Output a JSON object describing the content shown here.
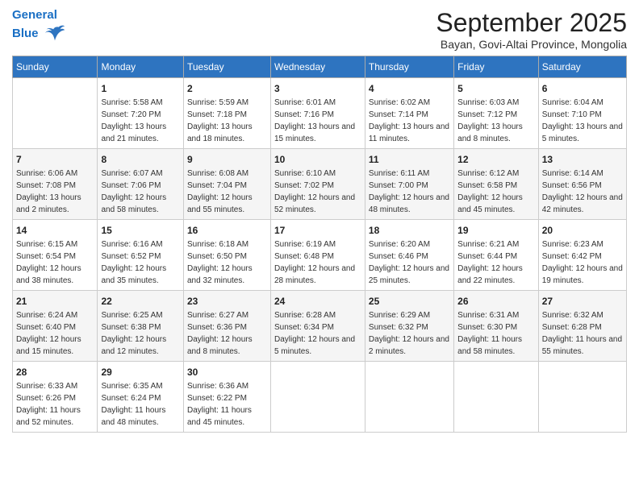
{
  "logo": {
    "line1": "General",
    "line2": "Blue"
  },
  "title": "September 2025",
  "subtitle": "Bayan, Govi-Altai Province, Mongolia",
  "days_of_week": [
    "Sunday",
    "Monday",
    "Tuesday",
    "Wednesday",
    "Thursday",
    "Friday",
    "Saturday"
  ],
  "weeks": [
    [
      {
        "num": "",
        "sunrise": "",
        "sunset": "",
        "daylight": ""
      },
      {
        "num": "1",
        "sunrise": "Sunrise: 5:58 AM",
        "sunset": "Sunset: 7:20 PM",
        "daylight": "Daylight: 13 hours and 21 minutes."
      },
      {
        "num": "2",
        "sunrise": "Sunrise: 5:59 AM",
        "sunset": "Sunset: 7:18 PM",
        "daylight": "Daylight: 13 hours and 18 minutes."
      },
      {
        "num": "3",
        "sunrise": "Sunrise: 6:01 AM",
        "sunset": "Sunset: 7:16 PM",
        "daylight": "Daylight: 13 hours and 15 minutes."
      },
      {
        "num": "4",
        "sunrise": "Sunrise: 6:02 AM",
        "sunset": "Sunset: 7:14 PM",
        "daylight": "Daylight: 13 hours and 11 minutes."
      },
      {
        "num": "5",
        "sunrise": "Sunrise: 6:03 AM",
        "sunset": "Sunset: 7:12 PM",
        "daylight": "Daylight: 13 hours and 8 minutes."
      },
      {
        "num": "6",
        "sunrise": "Sunrise: 6:04 AM",
        "sunset": "Sunset: 7:10 PM",
        "daylight": "Daylight: 13 hours and 5 minutes."
      }
    ],
    [
      {
        "num": "7",
        "sunrise": "Sunrise: 6:06 AM",
        "sunset": "Sunset: 7:08 PM",
        "daylight": "Daylight: 13 hours and 2 minutes."
      },
      {
        "num": "8",
        "sunrise": "Sunrise: 6:07 AM",
        "sunset": "Sunset: 7:06 PM",
        "daylight": "Daylight: 12 hours and 58 minutes."
      },
      {
        "num": "9",
        "sunrise": "Sunrise: 6:08 AM",
        "sunset": "Sunset: 7:04 PM",
        "daylight": "Daylight: 12 hours and 55 minutes."
      },
      {
        "num": "10",
        "sunrise": "Sunrise: 6:10 AM",
        "sunset": "Sunset: 7:02 PM",
        "daylight": "Daylight: 12 hours and 52 minutes."
      },
      {
        "num": "11",
        "sunrise": "Sunrise: 6:11 AM",
        "sunset": "Sunset: 7:00 PM",
        "daylight": "Daylight: 12 hours and 48 minutes."
      },
      {
        "num": "12",
        "sunrise": "Sunrise: 6:12 AM",
        "sunset": "Sunset: 6:58 PM",
        "daylight": "Daylight: 12 hours and 45 minutes."
      },
      {
        "num": "13",
        "sunrise": "Sunrise: 6:14 AM",
        "sunset": "Sunset: 6:56 PM",
        "daylight": "Daylight: 12 hours and 42 minutes."
      }
    ],
    [
      {
        "num": "14",
        "sunrise": "Sunrise: 6:15 AM",
        "sunset": "Sunset: 6:54 PM",
        "daylight": "Daylight: 12 hours and 38 minutes."
      },
      {
        "num": "15",
        "sunrise": "Sunrise: 6:16 AM",
        "sunset": "Sunset: 6:52 PM",
        "daylight": "Daylight: 12 hours and 35 minutes."
      },
      {
        "num": "16",
        "sunrise": "Sunrise: 6:18 AM",
        "sunset": "Sunset: 6:50 PM",
        "daylight": "Daylight: 12 hours and 32 minutes."
      },
      {
        "num": "17",
        "sunrise": "Sunrise: 6:19 AM",
        "sunset": "Sunset: 6:48 PM",
        "daylight": "Daylight: 12 hours and 28 minutes."
      },
      {
        "num": "18",
        "sunrise": "Sunrise: 6:20 AM",
        "sunset": "Sunset: 6:46 PM",
        "daylight": "Daylight: 12 hours and 25 minutes."
      },
      {
        "num": "19",
        "sunrise": "Sunrise: 6:21 AM",
        "sunset": "Sunset: 6:44 PM",
        "daylight": "Daylight: 12 hours and 22 minutes."
      },
      {
        "num": "20",
        "sunrise": "Sunrise: 6:23 AM",
        "sunset": "Sunset: 6:42 PM",
        "daylight": "Daylight: 12 hours and 19 minutes."
      }
    ],
    [
      {
        "num": "21",
        "sunrise": "Sunrise: 6:24 AM",
        "sunset": "Sunset: 6:40 PM",
        "daylight": "Daylight: 12 hours and 15 minutes."
      },
      {
        "num": "22",
        "sunrise": "Sunrise: 6:25 AM",
        "sunset": "Sunset: 6:38 PM",
        "daylight": "Daylight: 12 hours and 12 minutes."
      },
      {
        "num": "23",
        "sunrise": "Sunrise: 6:27 AM",
        "sunset": "Sunset: 6:36 PM",
        "daylight": "Daylight: 12 hours and 8 minutes."
      },
      {
        "num": "24",
        "sunrise": "Sunrise: 6:28 AM",
        "sunset": "Sunset: 6:34 PM",
        "daylight": "Daylight: 12 hours and 5 minutes."
      },
      {
        "num": "25",
        "sunrise": "Sunrise: 6:29 AM",
        "sunset": "Sunset: 6:32 PM",
        "daylight": "Daylight: 12 hours and 2 minutes."
      },
      {
        "num": "26",
        "sunrise": "Sunrise: 6:31 AM",
        "sunset": "Sunset: 6:30 PM",
        "daylight": "Daylight: 11 hours and 58 minutes."
      },
      {
        "num": "27",
        "sunrise": "Sunrise: 6:32 AM",
        "sunset": "Sunset: 6:28 PM",
        "daylight": "Daylight: 11 hours and 55 minutes."
      }
    ],
    [
      {
        "num": "28",
        "sunrise": "Sunrise: 6:33 AM",
        "sunset": "Sunset: 6:26 PM",
        "daylight": "Daylight: 11 hours and 52 minutes."
      },
      {
        "num": "29",
        "sunrise": "Sunrise: 6:35 AM",
        "sunset": "Sunset: 6:24 PM",
        "daylight": "Daylight: 11 hours and 48 minutes."
      },
      {
        "num": "30",
        "sunrise": "Sunrise: 6:36 AM",
        "sunset": "Sunset: 6:22 PM",
        "daylight": "Daylight: 11 hours and 45 minutes."
      },
      {
        "num": "",
        "sunrise": "",
        "sunset": "",
        "daylight": ""
      },
      {
        "num": "",
        "sunrise": "",
        "sunset": "",
        "daylight": ""
      },
      {
        "num": "",
        "sunrise": "",
        "sunset": "",
        "daylight": ""
      },
      {
        "num": "",
        "sunrise": "",
        "sunset": "",
        "daylight": ""
      }
    ]
  ]
}
